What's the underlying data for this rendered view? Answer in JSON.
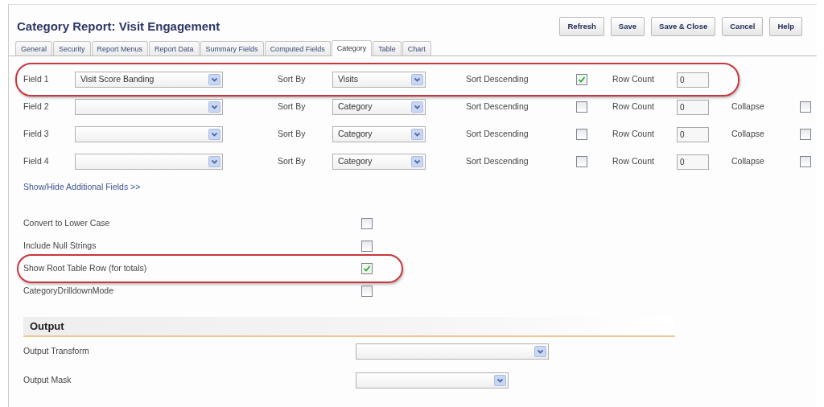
{
  "title": "Category Report: Visit Engagement",
  "buttons": [
    "Refresh",
    "Save",
    "Save & Close",
    "Cancel",
    "Help"
  ],
  "tabs": [
    {
      "label": "General",
      "selected": false
    },
    {
      "label": "Security",
      "selected": false
    },
    {
      "label": "Report Menus",
      "selected": false
    },
    {
      "label": "Report Data",
      "selected": false
    },
    {
      "label": "Summary Fields",
      "selected": false
    },
    {
      "label": "Computed Fields",
      "selected": false
    },
    {
      "label": "Category",
      "selected": true
    },
    {
      "label": "Table",
      "selected": false
    },
    {
      "label": "Chart",
      "selected": false
    }
  ],
  "fields": [
    {
      "label": "Field 1",
      "value": "Visit Score Banding",
      "sort_by_label": "Sort By",
      "sort_by": "Visits",
      "sort_descending_label": "Sort Descending",
      "sort_descending": true,
      "row_count_label": "Row Count",
      "row_count": "0",
      "highlighted": true
    },
    {
      "label": "Field 2",
      "sort_by_label": "Sort By",
      "sort_by": "Category",
      "sort_descending_label": "Sort Descending",
      "sort_descending": false,
      "row_count_label": "Row Count",
      "row_count": "0",
      "collapse_label": "Collapse",
      "collapse": false,
      "highlighted": false
    },
    {
      "label": "Field 3",
      "sort_by_label": "Sort By",
      "sort_by": "Category",
      "sort_descending_label": "Sort Descending",
      "sort_descending": false,
      "row_count_label": "Row Count",
      "row_count": "0",
      "collapse_label": "Collapse",
      "collapse": false,
      "highlighted": false
    },
    {
      "label": "Field 4",
      "sort_by_label": "Sort By",
      "sort_by": "Category",
      "sort_descending_label": "Sort Descending",
      "sort_descending": false,
      "row_count_label": "Row Count",
      "row_count": "0",
      "collapse_label": "Collapse",
      "collapse": false,
      "highlighted": false
    }
  ],
  "toggle_link": "Show/Hide Additional Fields >>",
  "options": [
    {
      "label": "Convert to Lower Case",
      "checked": false,
      "highlighted": false
    },
    {
      "label": "Include Null Strings",
      "checked": false,
      "highlighted": false
    },
    {
      "label": "Show Root Table Row (for totals)",
      "checked": true,
      "highlighted": true
    },
    {
      "label": "CategoryDrilldownMode",
      "checked": false,
      "highlighted": false
    }
  ],
  "output": {
    "heading": "Output",
    "fields": [
      {
        "label": "Output Transform"
      },
      {
        "label": "Output Mask"
      }
    ]
  }
}
